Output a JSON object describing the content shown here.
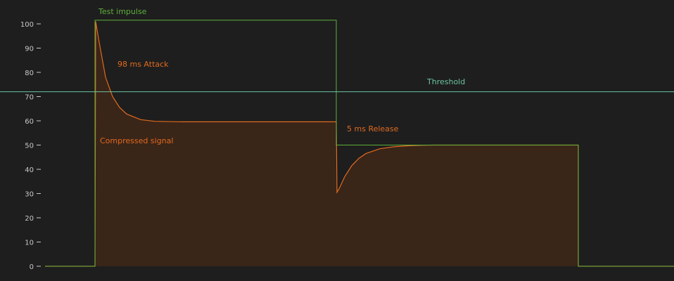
{
  "chart_data": {
    "type": "area",
    "title": "",
    "xlabel": "",
    "ylabel": "",
    "ylim": [
      0,
      100
    ],
    "xlim": [
      0,
      958
    ],
    "grid": false,
    "y_ticks": [
      0,
      10,
      20,
      30,
      40,
      50,
      60,
      70,
      80,
      90,
      100
    ],
    "threshold": {
      "value": 72,
      "label": "Threshold"
    },
    "series": [
      {
        "name": "Test impulse",
        "label": "Test impulse",
        "x": [
          64,
          135,
          135,
          478,
          478,
          822,
          822,
          958
        ],
        "y": [
          0,
          0,
          101.5,
          101.5,
          50,
          50,
          0,
          0
        ]
      },
      {
        "name": "Compressed signal",
        "label": "Compressed signal",
        "x": [
          64,
          135,
          136,
          140,
          145,
          150,
          160,
          170,
          180,
          200,
          220,
          260,
          300,
          400,
          478,
          479,
          482,
          490,
          500,
          510,
          520,
          540,
          560,
          580,
          600,
          615,
          700,
          822,
          822,
          958
        ],
        "y": [
          0,
          0,
          101,
          94,
          86,
          78,
          70,
          65.5,
          62.8,
          60.5,
          59.8,
          59.6,
          59.6,
          59.6,
          59.6,
          30.5,
          32,
          37,
          41.5,
          44.5,
          46.5,
          48.5,
          49.3,
          49.7,
          49.9,
          50,
          50,
          50,
          0,
          0
        ]
      }
    ],
    "annotations": {
      "attack": "98 ms Attack",
      "release": "5 ms Release"
    },
    "colors": {
      "background": "#1e1e1e",
      "impulse": "#5fae3a",
      "signal": "#e06a1e",
      "signal_fill": "#3a2519",
      "threshold": "#6cc4a0",
      "axis_text": "#c8c8c8"
    }
  }
}
